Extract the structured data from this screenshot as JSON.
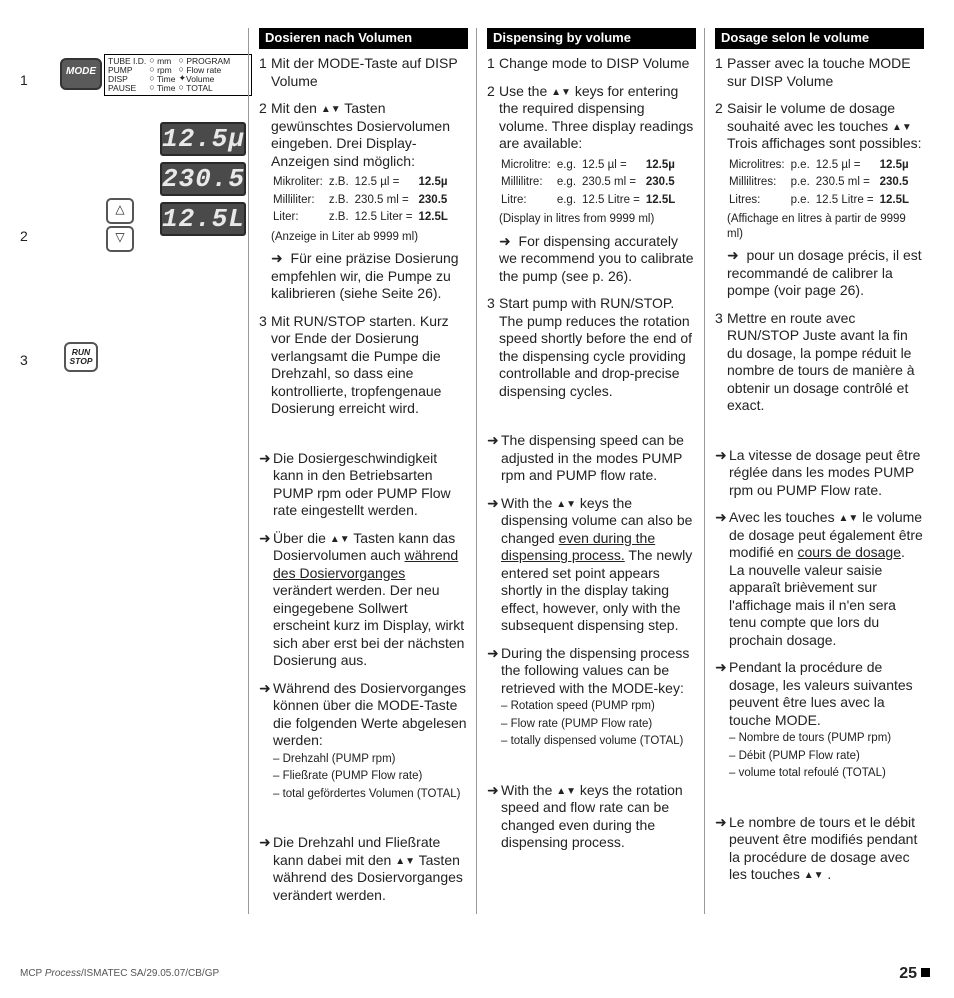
{
  "left": {
    "step1": "1",
    "step2": "2",
    "step3": "3",
    "modeBtn": "MODE",
    "runBtn1": "RUN",
    "runBtn2": "STOP",
    "disp1": "12.5µ",
    "disp2": "230.5",
    "disp3": "12.5L",
    "tbl": {
      "r1c1": "TUBE I.D.",
      "r1c2": "mm",
      "r1c3": "PROGRAM",
      "r2c1": "PUMP",
      "r2c2": "rpm",
      "r2c3": "Flow rate",
      "r3c1": "DISP",
      "r3c2": "Time",
      "r3c3": "Volume",
      "r4c1": "PAUSE",
      "r4c2": "Time",
      "r4c3": "TOTAL"
    }
  },
  "de": {
    "hdr": "Dosieren nach Volumen",
    "i1": "Mit der MODE-Taste auf DISP Volume",
    "i2a": "Mit den ",
    "i2b": " Tasten gewünschtes Dosiervolumen eingeben. Drei Display-Anzeigen sind möglich:",
    "u_mic_l": "Mikroliter:",
    "u_mic_m": "z.B.",
    "u_mic_v": "12.5 µl  =",
    "u_mic_b": "12.5µ",
    "u_mil_l": "Milliliter:",
    "u_mil_m": "z.B.",
    "u_mil_v": "230.5 ml =",
    "u_mil_b": "230.5",
    "u_lit_l": "Liter:",
    "u_lit_m": "z.B.",
    "u_lit_v": "12.5 Liter =",
    "u_lit_b": "12.5L",
    "u_note": "(Anzeige in Liter ab 9999 ml)",
    "i2c": "Für eine präzise Dosierung empfehlen wir, die Pumpe zu kalibrieren (siehe Seite 26).",
    "i3": "Mit RUN/STOP starten. Kurz vor Ende der Dosierung verlangsamt die Pumpe die Drehzahl, so dass eine kontrollierte, tropfengenaue Dosierung erreicht wird.",
    "a1": "Die Dosiergeschwindigkeit kann in den  Betriebsarten PUMP rpm oder PUMP Flow rate eingestellt werden.",
    "a2a": "Über die ",
    "a2b": " Tasten kann das Dosiervolumen auch ",
    "a2u": "während des Dosiervorganges",
    "a2c": " verändert werden. Der neu eingegebene Sollwert erscheint kurz im Display,  wirkt sich aber erst bei der nächsten Dosierung aus.",
    "a3": "Während des Dosiervorganges können über die MODE-Taste die folgenden Werte abgelesen werden:",
    "a3s1": "– Drehzahl (PUMP rpm)",
    "a3s2": "– Fließrate (PUMP Flow rate)",
    "a3s3": "– total gefördertes Volumen (TOTAL)",
    "a4a": "Die Drehzahl und Fließrate kann dabei mit den ",
    "a4b": " Tasten während des Dosiervorganges verändert werden."
  },
  "en": {
    "hdr": "Dispensing by volume",
    "i1": "Change mode to DISP Volume",
    "i2a": "Use the ",
    "i2b": " keys for entering the required dispensing volume. Three display readings are  available:",
    "u_mic_l": "Microlitre:",
    "u_mic_m": "e.g.",
    "u_mic_v": "12.5 µl  =",
    "u_mic_b": "12.5µ",
    "u_mil_l": "Millilitre:",
    "u_mil_m": "e.g.",
    "u_mil_v": "230.5 ml =",
    "u_mil_b": "230.5",
    "u_lit_l": "Litre:",
    "u_lit_m": "e.g.",
    "u_lit_v": "12.5 Litre =",
    "u_lit_b": "12.5L",
    "u_note": "(Display in litres from 9999 ml)",
    "i2c": "For dispensing accurately we recommend you to calibrate the pump (see p. 26).",
    "i3": "Start pump with RUN/STOP. The pump reduces the rotation speed shortly before the end of the dispensing cycle providing controllable and drop-precise dispensing cycles.",
    "a1": "The dispensing speed can be adjusted in the modes PUMP rpm and PUMP flow rate.",
    "a2a": "With the ",
    "a2b": " keys the dispensing volume can  also be changed ",
    "a2u": "even during the dispensing process.",
    "a2c": " The newly entered set point appears shortly in the display taking effect, however, only with the subsequent dispensing step.",
    "a3": "During the dispensing process the following values can be retrieved with the MODE-key:",
    "a3s1": "– Rotation speed (PUMP rpm)",
    "a3s2": "– Flow rate (PUMP Flow rate)",
    "a3s3": "– totally dispensed volume (TOTAL)",
    "a4a": "With the ",
    "a4b": " keys the rotation speed and flow rate can be changed even during the dispensing process."
  },
  "fr": {
    "hdr": "Dosage selon le volume",
    "i1": "Passer avec la touche MODE sur DISP Volume",
    "i2a": "Saisir le volume de dosage souhaité avec les touches ",
    "i2b": " Trois affichages sont possibles:",
    "u_mic_l": "Microlitres:",
    "u_mic_m": "p.e.",
    "u_mic_v": "12.5 µl  =",
    "u_mic_b": "12.5µ",
    "u_mil_l": "Millilitres:",
    "u_mil_m": "p.e.",
    "u_mil_v": "230.5 ml =",
    "u_mil_b": "230.5",
    "u_lit_l": "Litres:",
    "u_lit_m": "p.e.",
    "u_lit_v": "12.5 Litre =",
    "u_lit_b": "12.5L",
    "u_note": "(Affichage en litres à partir de 9999 ml)",
    "i2c": "pour un dosage précis, il est recommandé de calibrer la pompe  (voir page 26).",
    "i3": "Mettre en route avec RUN/STOP Juste avant la fin du dosage, la pompe réduit le nombre de tours de manière à obtenir un dosage contrôlé et exact.",
    "a1": "La vitesse de dosage peut être réglée dans les modes PUMP rpm ou PUMP Flow rate.",
    "a2a": "Avec les touches ",
    "a2b": "  le volume de dosage peut également être modifié en ",
    "a2u": "cours de dosage",
    "a2c": ". La nouvelle valeur saisie apparaît brièvement sur l'affichage mais il n'en sera tenu compte que lors du prochain dosage.",
    "a3": "Pendant la procédure de dosage, les valeurs suivantes peuvent être lues avec la touche MODE.",
    "a3s1": "– Nombre de tours (PUMP rpm)",
    "a3s2": "– Débit (PUMP Flow rate)",
    "a3s3": "– volume total refoulé (TOTAL)",
    "a4a": "Le nombre de tours et le débit peuvent être modifiés pendant la procédure de dosage avec les touches ",
    "a4b": " ."
  },
  "footer": "MCP Process/ISMATEC SA/29.05.07/CB/GP",
  "pagenum": "25",
  "glyph": {
    "updown": "▲▼",
    "arrow": "➜",
    "up": "△",
    "dn": "▽",
    "dot": "○",
    "fdot": "✦"
  }
}
